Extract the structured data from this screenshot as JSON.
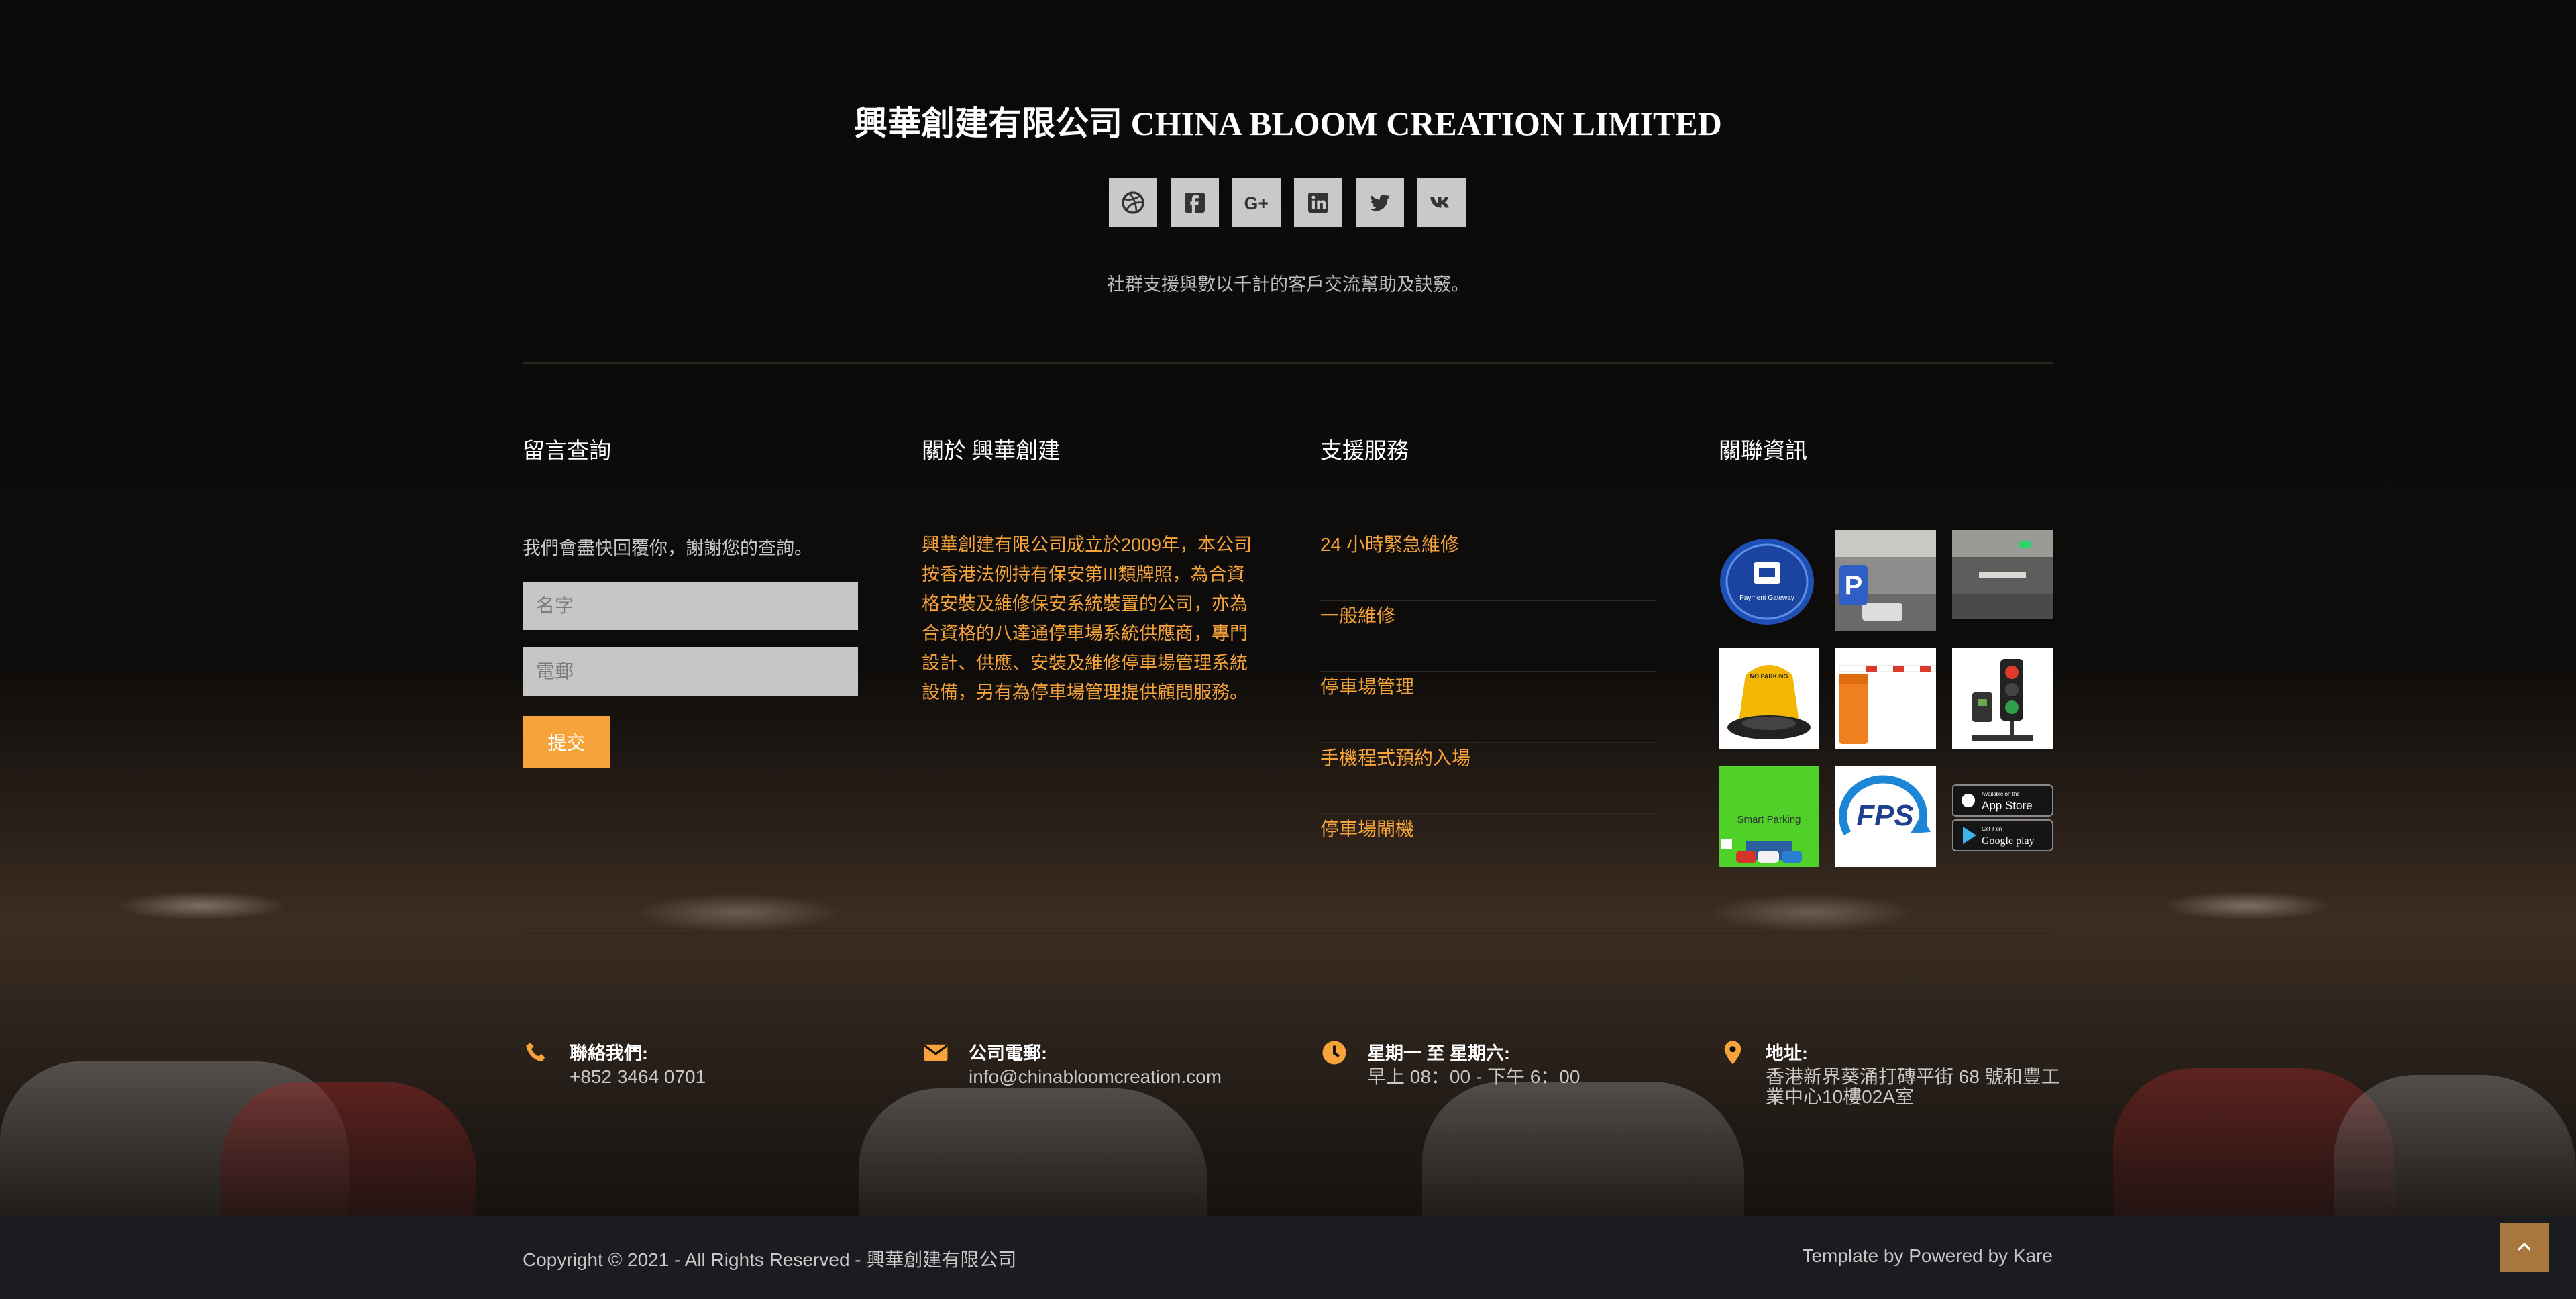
{
  "header": {
    "company": "興華創建有限公司 CHINA BLOOM CREATION LIMITED",
    "tagline": "社群支援與數以千計的客戶交流幫助及訣竅。"
  },
  "social": [
    {
      "name": "dribbble",
      "icon": "dribbble-icon"
    },
    {
      "name": "facebook",
      "icon": "facebook-icon",
      "glyph": "f"
    },
    {
      "name": "google-plus",
      "icon": "google-plus-icon",
      "glyph": "G+"
    },
    {
      "name": "linkedin",
      "icon": "linkedin-icon",
      "glyph": "in"
    },
    {
      "name": "twitter",
      "icon": "twitter-icon"
    },
    {
      "name": "vk",
      "icon": "vk-icon",
      "glyph": "vk"
    }
  ],
  "inquiry": {
    "title": "留言查詢",
    "intro": "我們會盡快回覆你，謝謝您的查詢。",
    "name_placeholder": "名字",
    "email_placeholder": "電郵",
    "submit_label": "提交"
  },
  "about": {
    "title": "關於 興華創建",
    "text": "興華創建有限公司成立於2009年，本公司按香港法例持有保安第III類牌照，為合資格安裝及維修保安系統裝置的公司，亦為合資格的八達通停車場系統供應商，專門設計、供應、安裝及維修停車場管理系統設備，另有為停車場管理提供顧問服務。"
  },
  "services": {
    "title": "支援服務",
    "items": [
      "24 小時緊急維修",
      "一般維修",
      "停車場管理",
      "手機程式預約入場",
      "停車場閘機"
    ]
  },
  "related": {
    "title": "關聯資訊",
    "tiles": [
      {
        "name": "payment-gateway",
        "label": "Payment Gateway"
      },
      {
        "name": "parking-sign"
      },
      {
        "name": "parking-ceiling"
      },
      {
        "name": "parking-lock",
        "label": "NO PARKING"
      },
      {
        "name": "barrier-gate"
      },
      {
        "name": "traffic-light"
      },
      {
        "name": "smart-parking",
        "label": "Smart Parking"
      },
      {
        "name": "fps",
        "label": "FPS"
      },
      {
        "name": "app-stores",
        "label": "App Store",
        "label2": "Google play",
        "label_small": "Available on the",
        "label_small2": "Get it on"
      }
    ]
  },
  "contact": [
    {
      "icon": "phone-icon",
      "label": "聯絡我們:",
      "value": "+852 3464 0701"
    },
    {
      "icon": "envelope-icon",
      "label": "公司電郵:",
      "value": "info@chinabloomcreation.com"
    },
    {
      "icon": "clock-icon",
      "label": "星期一 至 星期六:",
      "value": "早上 08：00 - 下午 6：00"
    },
    {
      "icon": "map-pin-icon",
      "label": "地址:",
      "value": "香港新界葵涌打磚平街 68 號和豐工業中心10樓02A室"
    }
  ],
  "footer": {
    "copyright": "Copyright © 2021 - All Rights Reserved - 興華創建有限公司",
    "credit": "Template by Powered by Kare"
  },
  "colors": {
    "accent": "#f5a33a",
    "background": "#0b0a09",
    "bottom_bar": "#1b1c20",
    "social_button": "#c9c9c9"
  }
}
